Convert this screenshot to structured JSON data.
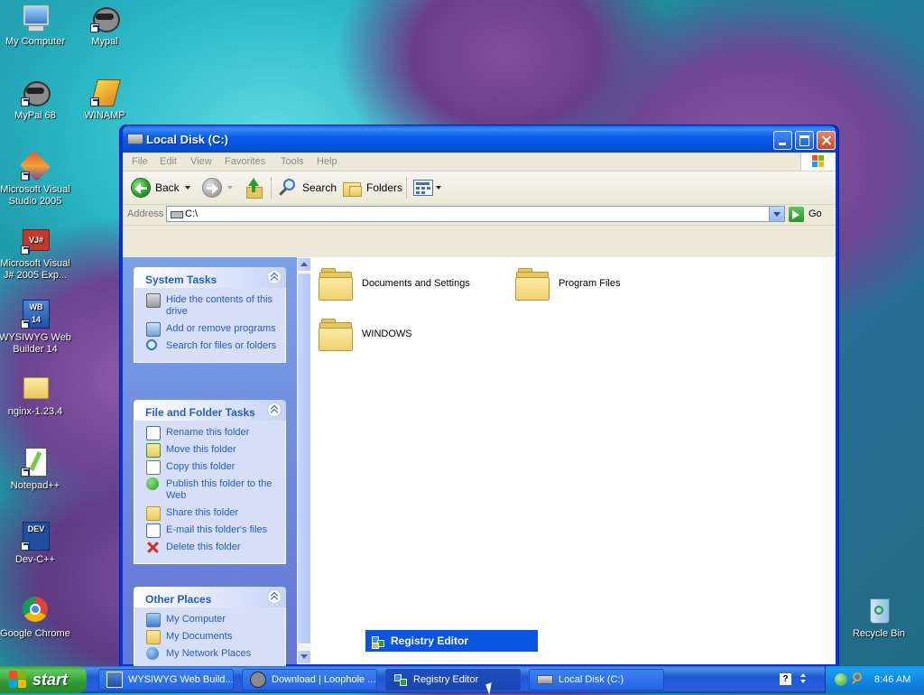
{
  "desktop": {
    "icons": [
      {
        "label": "My Computer"
      },
      {
        "label": "Mypal"
      },
      {
        "label": "MyPal 68"
      },
      {
        "label": "WINAMP"
      },
      {
        "label": "Microsoft Visual Studio 2005"
      },
      {
        "label": "Microsoft Visual J# 2005 Exp..."
      },
      {
        "label": "WYSIWYG Web Builder 14"
      },
      {
        "label": "nginx-1.23.4"
      },
      {
        "label": "Notepad++"
      },
      {
        "label": "Dev-C++"
      },
      {
        "label": "Google Chrome"
      },
      {
        "label": "Recycle Bin"
      }
    ]
  },
  "window": {
    "title": "Local Disk (C:)",
    "menu": [
      "File",
      "Edit",
      "View",
      "Favorites",
      "Tools",
      "Help"
    ],
    "toolbar": {
      "back_label": "Back",
      "search_label": "Search",
      "folders_label": "Folders"
    },
    "address": {
      "label": "Address",
      "value": "C:\\",
      "go_label": "Go"
    },
    "tasks": {
      "system": {
        "title": "System Tasks",
        "items": [
          "Hide the contents of this drive",
          "Add or remove programs",
          "Search for files or folders"
        ]
      },
      "file_folder": {
        "title": "File and Folder Tasks",
        "items": [
          "Rename this folder",
          "Move this folder",
          "Copy this folder",
          "Publish this folder to the Web",
          "Share this folder",
          "E-mail this folder's files",
          "Delete this folder"
        ]
      },
      "other": {
        "title": "Other Places",
        "items": [
          "My Computer",
          "My Documents",
          "My Network Places"
        ]
      }
    },
    "files": [
      "Documents and Settings",
      "Program Files",
      "WINDOWS"
    ]
  },
  "popup": {
    "label": "Registry Editor"
  },
  "taskbar": {
    "start_label": "start",
    "tasks": [
      "WYSIWYG Web Build...",
      "Download | Loophole ...",
      "Registry Editor",
      "Local Disk (C:)"
    ],
    "clock": "8:46 AM",
    "help_label": "?"
  }
}
